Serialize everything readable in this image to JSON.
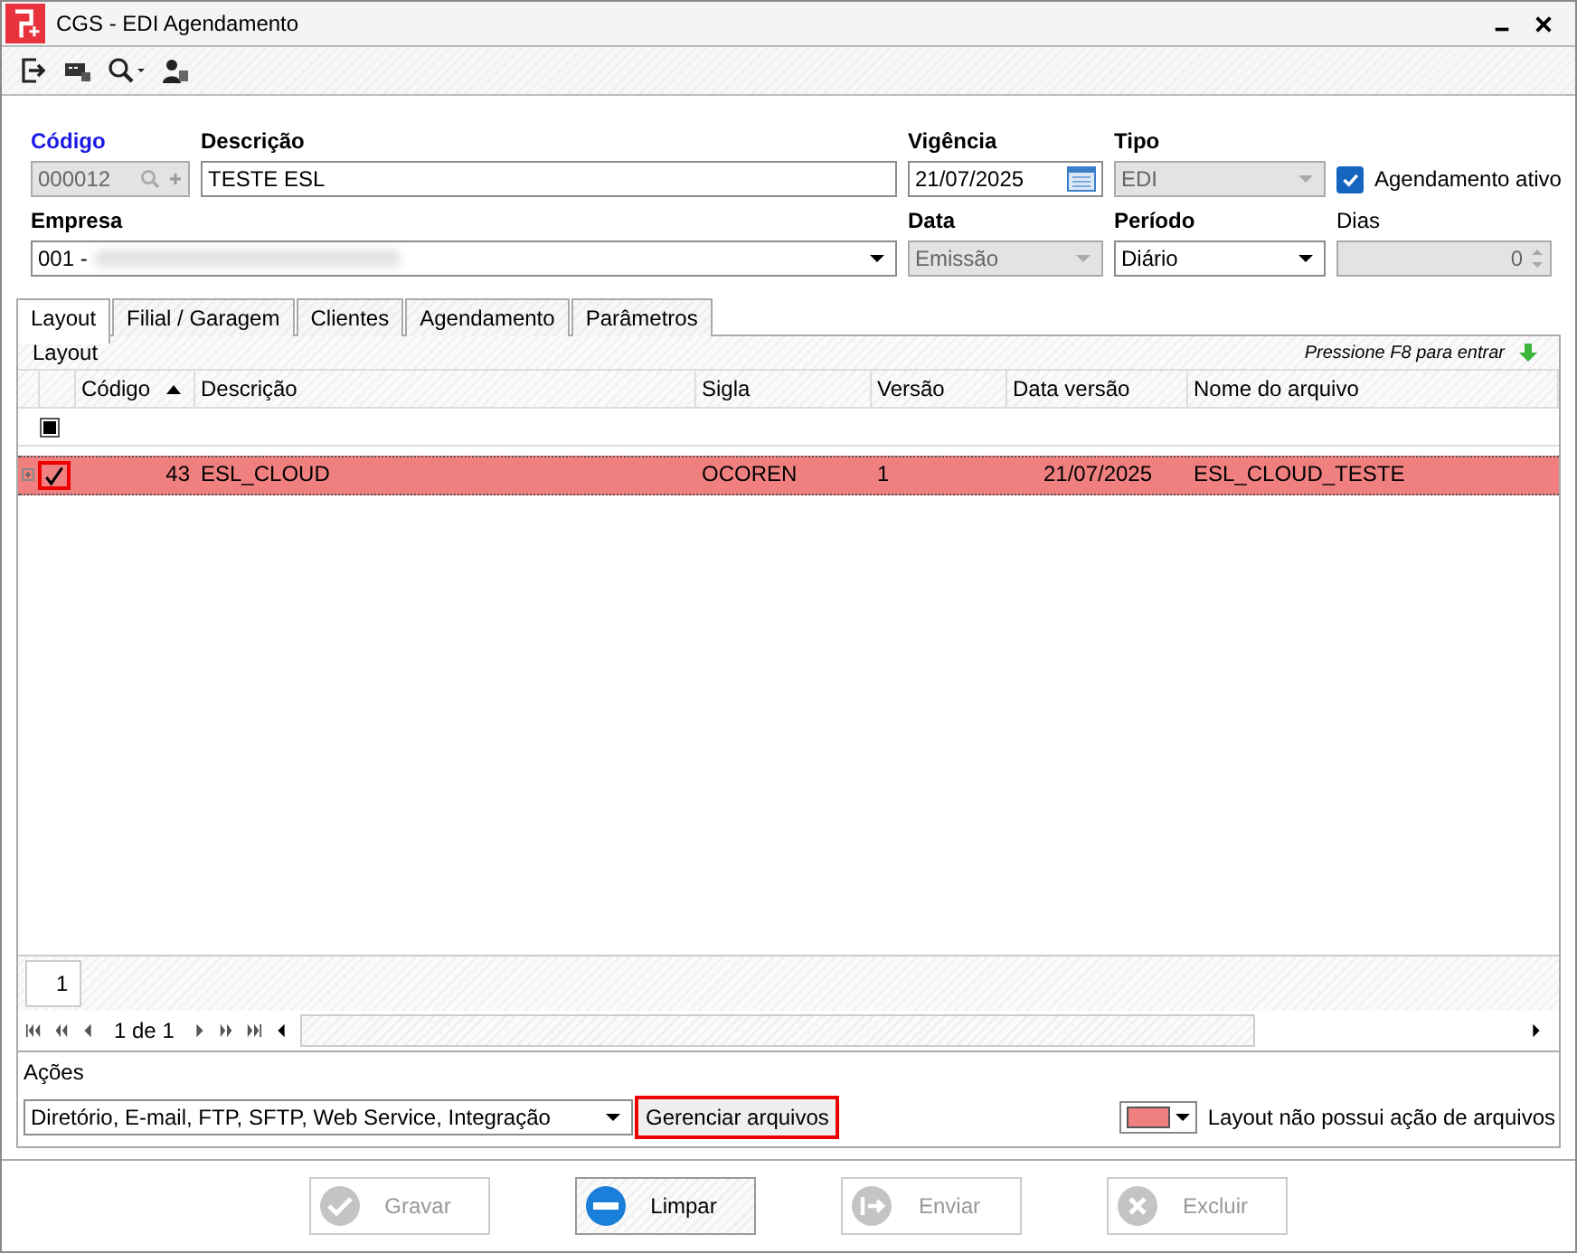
{
  "window": {
    "title": "CGS - EDI Agendamento"
  },
  "form": {
    "codigo": {
      "label": "Código",
      "value": "000012",
      "required": true,
      "key": true,
      "disabled": true
    },
    "descricao": {
      "label": "Descrição",
      "value": "TESTE ESL",
      "required": true
    },
    "vigencia": {
      "label": "Vigência",
      "value": "21/07/2025",
      "required": true
    },
    "tipo": {
      "label": "Tipo",
      "value": "EDI",
      "required": true,
      "disabled": true
    },
    "agendamento_ativo": {
      "label": "Agendamento ativo",
      "checked": true
    },
    "empresa": {
      "label": "Empresa",
      "value": "001 -",
      "required": true
    },
    "data": {
      "label": "Data",
      "value": "Emissão",
      "required": true,
      "disabled": true
    },
    "periodo": {
      "label": "Período",
      "value": "Diário",
      "required": true,
      "disabled": false
    },
    "dias": {
      "label": "Dias",
      "value": "0",
      "required": false,
      "disabled": true
    }
  },
  "tabs": [
    {
      "label": "Layout",
      "selected": true
    },
    {
      "label": "Filial / Garagem",
      "selected": false
    },
    {
      "label": "Clientes",
      "selected": false
    },
    {
      "label": "Agendamento",
      "selected": false
    },
    {
      "label": "Parâmetros",
      "selected": false
    }
  ],
  "grid": {
    "title": "Layout",
    "hint": "Pressione F8 para entrar",
    "columns": [
      {
        "label": "Código",
        "sorted": true
      },
      {
        "label": "Descrição",
        "sorted": false
      },
      {
        "label": "Sigla",
        "sorted": false
      },
      {
        "label": "Versão",
        "sorted": false
      },
      {
        "label": "Data versão",
        "sorted": false
      },
      {
        "label": "Nome do arquivo",
        "sorted": false
      }
    ],
    "rows": [
      {
        "codigo": "43",
        "descricao": "ESL_CLOUD",
        "sigla": "OCOREN",
        "versao": "1",
        "data_versao": "21/07/2025",
        "nome_arquivo": "ESL_CLOUD_TESTE",
        "checked": true,
        "color": "#f08080"
      }
    ],
    "select_all_indeterminate": true,
    "page_number": "1",
    "pager": "1 de 1"
  },
  "acoes": {
    "label": "Ações",
    "value": "Diretório, E-mail, FTP, SFTP, Web Service, Integração",
    "button": "Gerenciar arquivos"
  },
  "legend": {
    "color": "#f08080",
    "label": "Layout não possui ação de arquivos"
  },
  "buttons": [
    {
      "label": "Gravar",
      "kind": "check",
      "disabled": true
    },
    {
      "label": "Limpar",
      "kind": "minus",
      "disabled": false
    },
    {
      "label": "Enviar",
      "kind": "send",
      "disabled": true
    },
    {
      "label": "Excluir",
      "kind": "cross",
      "disabled": true
    }
  ]
}
